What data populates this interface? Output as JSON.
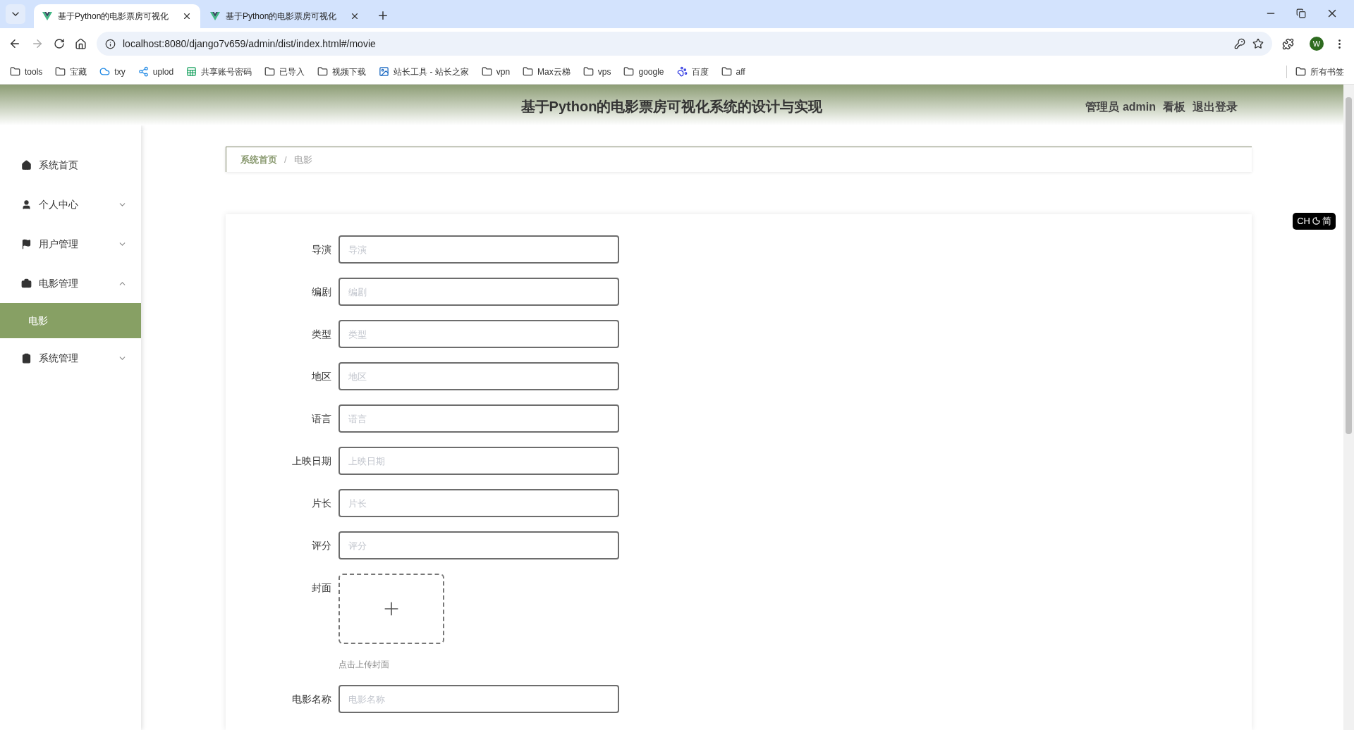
{
  "browser": {
    "tabs": [
      {
        "title": "基于Python的电影票房可视化",
        "selected": true
      },
      {
        "title": "基于Python的电影票房可视化",
        "selected": false
      }
    ],
    "url": "localhost:8080/django7v659/admin/dist/index.html#/movie",
    "profile": "W",
    "bookmarks": [
      {
        "label": "tools",
        "kind": "folder"
      },
      {
        "label": "宝藏",
        "kind": "folder"
      },
      {
        "label": "txy",
        "kind": "cloud"
      },
      {
        "label": "uplod",
        "kind": "link"
      },
      {
        "label": "共享账号密码",
        "kind": "sheet"
      },
      {
        "label": "已导入",
        "kind": "folder"
      },
      {
        "label": "视频下载",
        "kind": "folder"
      },
      {
        "label": "站长工具 - 站长之家",
        "kind": "site"
      },
      {
        "label": "vpn",
        "kind": "folder"
      },
      {
        "label": "Max云梯",
        "kind": "folder"
      },
      {
        "label": "vps",
        "kind": "folder"
      },
      {
        "label": "google",
        "kind": "folder"
      },
      {
        "label": "百度",
        "kind": "paw"
      },
      {
        "label": "aff",
        "kind": "folder"
      }
    ],
    "all_bookmarks": "所有书签"
  },
  "app": {
    "title": "基于Python的电影票房可视化系统的设计与实现",
    "user": "管理员 admin",
    "header_links": [
      "看板",
      "退出登录"
    ],
    "sidebar": [
      {
        "label": "系统首页"
      },
      {
        "label": "个人中心",
        "expanded": false
      },
      {
        "label": "用户管理",
        "expanded": false
      },
      {
        "label": "电影管理",
        "expanded": true,
        "children": [
          {
            "label": "电影",
            "selected": true
          }
        ]
      },
      {
        "label": "系统管理",
        "expanded": false
      }
    ],
    "breadcrumb": [
      "系统首页",
      "电影"
    ],
    "breadcrumb_separator": "/",
    "form": [
      {
        "kind": "text",
        "label": "导演",
        "placeholder": "导演"
      },
      {
        "kind": "text",
        "label": "编剧",
        "placeholder": "编剧"
      },
      {
        "kind": "text",
        "label": "类型",
        "placeholder": "类型"
      },
      {
        "kind": "text",
        "label": "地区",
        "placeholder": "地区"
      },
      {
        "kind": "text",
        "label": "语言",
        "placeholder": "语言"
      },
      {
        "kind": "text",
        "label": "上映日期",
        "placeholder": "上映日期"
      },
      {
        "kind": "text",
        "label": "片长",
        "placeholder": "片长"
      },
      {
        "kind": "text",
        "label": "评分",
        "placeholder": "评分"
      },
      {
        "kind": "upload",
        "label": "封面",
        "hint": "点击上传封面"
      },
      {
        "kind": "text",
        "label": "电影名称",
        "placeholder": "电影名称"
      }
    ]
  },
  "ime": {
    "mode": "CH",
    "script": "简"
  }
}
